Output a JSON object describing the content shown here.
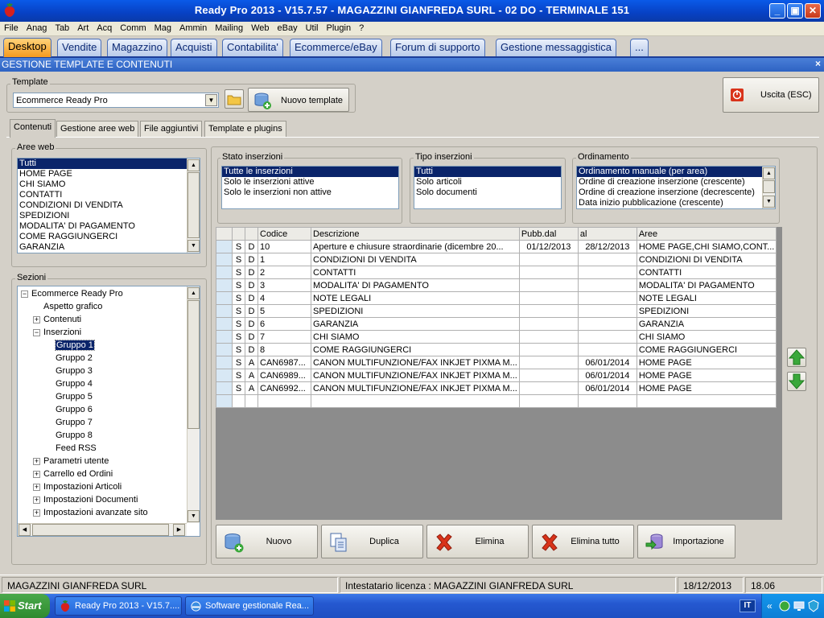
{
  "window": {
    "title": "Ready Pro 2013 - V15.7.57 - MAGAZZINI GIANFREDA SURL - 02 DO - TERMINALE 151",
    "minimize": "_",
    "maximize": "▣",
    "close": "✕"
  },
  "menu": [
    "File",
    "Anag",
    "Tab",
    "Art",
    "Acq",
    "Comm",
    "Mag",
    "Ammin",
    "Mailing",
    "Web",
    "eBay",
    "Util",
    "Plugin",
    "?"
  ],
  "main_tabs": [
    "Desktop",
    "Vendite",
    "Magazzino",
    "Acquisti",
    "Contabilita'",
    "Ecommerce/eBay",
    "Forum di supporto",
    "Gestione messaggistica",
    "..."
  ],
  "section": {
    "title": "GESTIONE TEMPLATE E CONTENUTI",
    "close": "×"
  },
  "template": {
    "label": "Template",
    "selected": "Ecommerce Ready Pro",
    "new_button": "Nuovo template"
  },
  "exit_button": "Uscita (ESC)",
  "sub_tabs": [
    "Contenuti",
    "Gestione aree web",
    "File aggiuntivi",
    "Template e plugins"
  ],
  "aree_web": {
    "label": "Aree web",
    "items": [
      "Tutti",
      "HOME PAGE",
      "CHI SIAMO",
      "CONTATTI",
      "CONDIZIONI DI VENDITA",
      "SPEDIZIONI",
      "MODALITA' DI PAGAMENTO",
      "COME RAGGIUNGERCI",
      "GARANZIA"
    ],
    "selected_index": 0
  },
  "sezioni": {
    "label": "Sezioni",
    "tree": [
      {
        "text": "Ecommerce Ready Pro",
        "level": 0,
        "toggle": "−"
      },
      {
        "text": "Aspetto grafico",
        "level": 1,
        "toggle": ""
      },
      {
        "text": "Contenuti",
        "level": 1,
        "toggle": "+"
      },
      {
        "text": "Inserzioni",
        "level": 1,
        "toggle": "−"
      },
      {
        "text": "Gruppo 1",
        "level": 2,
        "toggle": "",
        "selected": true
      },
      {
        "text": "Gruppo 2",
        "level": 2,
        "toggle": ""
      },
      {
        "text": "Gruppo 3",
        "level": 2,
        "toggle": ""
      },
      {
        "text": "Gruppo 4",
        "level": 2,
        "toggle": ""
      },
      {
        "text": "Gruppo 5",
        "level": 2,
        "toggle": ""
      },
      {
        "text": "Gruppo 6",
        "level": 2,
        "toggle": ""
      },
      {
        "text": "Gruppo 7",
        "level": 2,
        "toggle": ""
      },
      {
        "text": "Gruppo 8",
        "level": 2,
        "toggle": ""
      },
      {
        "text": "Feed RSS",
        "level": 2,
        "toggle": ""
      },
      {
        "text": "Parametri utente",
        "level": 1,
        "toggle": "+"
      },
      {
        "text": "Carrello ed Ordini",
        "level": 1,
        "toggle": "+"
      },
      {
        "text": "Impostazioni Articoli",
        "level": 1,
        "toggle": "+"
      },
      {
        "text": "Impostazioni Documenti",
        "level": 1,
        "toggle": "+"
      },
      {
        "text": "Impostazioni avanzate sito",
        "level": 1,
        "toggle": "+"
      }
    ]
  },
  "stato_inserzioni": {
    "label": "Stato inserzioni",
    "items": [
      "Tutte le inserzioni",
      "Solo le inserzioni attive",
      "Solo le inserzioni non attive"
    ],
    "selected_index": 0
  },
  "tipo_inserzioni": {
    "label": "Tipo inserzioni",
    "items": [
      "Tutti",
      "Solo articoli",
      "Solo documenti"
    ],
    "selected_index": 0
  },
  "ordinamento": {
    "label": "Ordinamento",
    "items": [
      "Ordinamento manuale (per area)",
      "Ordine di creazione inserzione (crescente)",
      "Ordine di creazione inserzione (decrescente)",
      "Data inizio pubblicazione (crescente)"
    ],
    "selected_index": 0
  },
  "grid": {
    "columns": [
      "",
      "",
      "",
      "Codice",
      "Descrizione",
      "Pubb.dal",
      "al",
      "Aree"
    ],
    "rows": [
      [
        "",
        "S",
        "D",
        "10",
        "Aperture e chiusure straordinarie (dicembre 20...",
        "01/12/2013",
        "28/12/2013",
        "HOME PAGE,CHI SIAMO,CONT..."
      ],
      [
        "",
        "S",
        "D",
        "1",
        "CONDIZIONI DI VENDITA",
        "",
        "",
        "CONDIZIONI DI VENDITA"
      ],
      [
        "",
        "S",
        "D",
        "2",
        "CONTATTI",
        "",
        "",
        "CONTATTI"
      ],
      [
        "",
        "S",
        "D",
        "3",
        "MODALITA' DI PAGAMENTO",
        "",
        "",
        "MODALITA' DI PAGAMENTO"
      ],
      [
        "",
        "S",
        "D",
        "4",
        "NOTE LEGALI",
        "",
        "",
        "NOTE LEGALI"
      ],
      [
        "",
        "S",
        "D",
        "5",
        "SPEDIZIONI",
        "",
        "",
        "SPEDIZIONI"
      ],
      [
        "",
        "S",
        "D",
        "6",
        "GARANZIA",
        "",
        "",
        "GARANZIA"
      ],
      [
        "",
        "S",
        "D",
        "7",
        "CHI SIAMO",
        "",
        "",
        "CHI SIAMO"
      ],
      [
        "",
        "S",
        "D",
        "8",
        "COME RAGGIUNGERCI",
        "",
        "",
        "COME RAGGIUNGERCI"
      ],
      [
        "",
        "S",
        "A",
        "CAN6987...",
        "CANON MULTIFUNZIONE/FAX INKJET PIXMA M...",
        "",
        "06/01/2014",
        "HOME PAGE"
      ],
      [
        "",
        "S",
        "A",
        "CAN6989...",
        "CANON MULTIFUNZIONE/FAX INKJET PIXMA M...",
        "",
        "06/01/2014",
        "HOME PAGE"
      ],
      [
        "",
        "S",
        "A",
        "CAN6992...",
        "CANON MULTIFUNZIONE/FAX INKJET PIXMA M...",
        "",
        "06/01/2014",
        "HOME PAGE"
      ],
      [
        "",
        "",
        "",
        "",
        "",
        "",
        "",
        ""
      ]
    ]
  },
  "actions": [
    "Nuovo",
    "Duplica",
    "Elimina",
    "Elimina tutto",
    "Importazione"
  ],
  "status": {
    "company": "MAGAZZINI GIANFREDA SURL",
    "license": "Intestatario licenza : MAGAZZINI GIANFREDA SURL",
    "date": "18/12/2013",
    "time": "18.06"
  },
  "taskbar": {
    "start": "Start",
    "items": [
      "Ready Pro 2013 - V15.7....",
      "Software gestionale Rea..."
    ],
    "lang": "IT",
    "tray_more": "«"
  },
  "colors": {
    "titlebar": "#0741c4",
    "active_tab": "#f59a1f",
    "selection": "#0a246a",
    "delete_red": "#d9331a",
    "arrow_green": "#3aa83a"
  }
}
